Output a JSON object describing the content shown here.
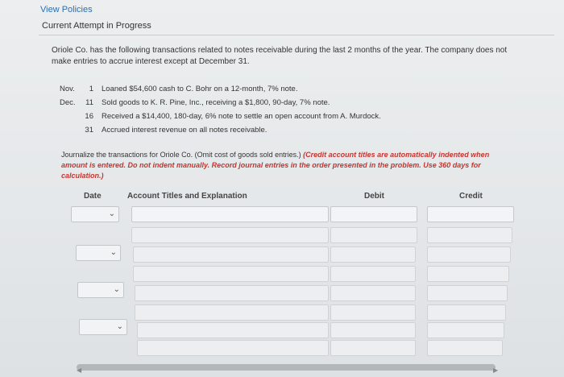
{
  "nav": {
    "view_policies": "View Policies",
    "attempt_status": "Current Attempt in Progress"
  },
  "problem": {
    "text": "Oriole Co. has the following transactions related to notes receivable during the last 2 months of the year. The company does not make entries to accrue interest except at December 31."
  },
  "transactions": [
    {
      "month": "Nov.",
      "day": "1",
      "desc": "Loaned $54,600 cash to C. Bohr on a 12-month, 7% note."
    },
    {
      "month": "Dec.",
      "day": "11",
      "desc": "Sold goods to K. R. Pine, Inc., receiving a $1,800, 90-day, 7% note."
    },
    {
      "month": "",
      "day": "16",
      "desc": "Received a $14,400, 180-day, 6% note to settle an open account from A. Murdock."
    },
    {
      "month": "",
      "day": "31",
      "desc": "Accrued interest revenue on all notes receivable."
    }
  ],
  "instructions": {
    "plain": "Journalize the transactions for Oriole Co. (Omit cost of goods sold entries.) ",
    "red": "(Credit account titles are automatically indented when amount is entered. Do not indent manually. Record journal entries in the order presented in the problem. Use 360 days for calculation.)"
  },
  "journal": {
    "headers": {
      "date": "Date",
      "account": "Account Titles and Explanation",
      "debit": "Debit",
      "credit": "Credit"
    },
    "date_value": "",
    "account_value": "",
    "amount_value": ""
  },
  "icons": {
    "dropdown": "chevron-down-icon"
  },
  "colors": {
    "link": "#2a6fb0",
    "instruction_red": "#c4352f"
  }
}
